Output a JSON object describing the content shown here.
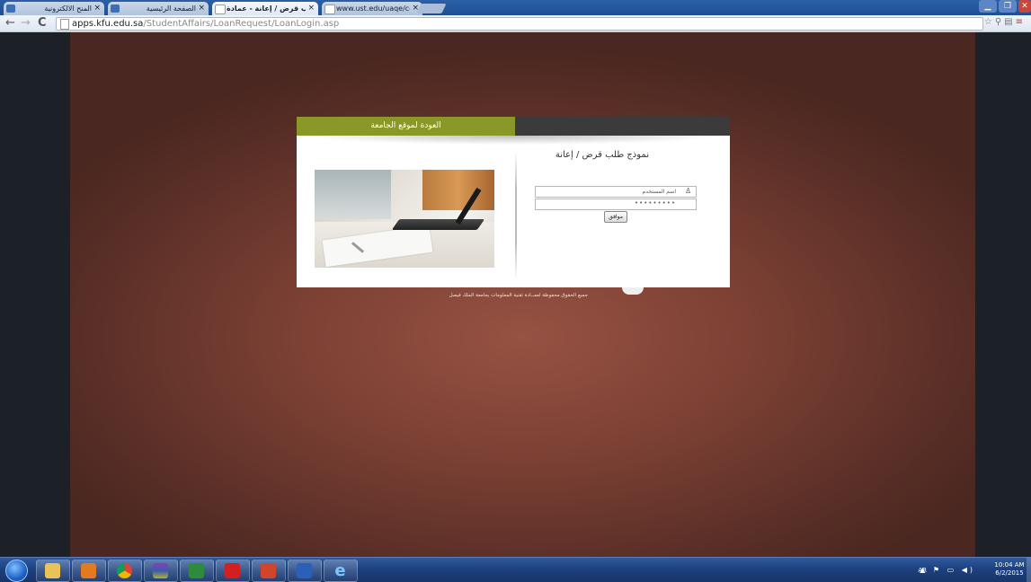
{
  "browser": {
    "tabs": [
      {
        "title": "المنح الالكترونية",
        "active": false
      },
      {
        "title": "الصفحة الرئيسية",
        "active": false
      },
      {
        "title": "نموذج طلب قرض / إعانة - عمادة",
        "active": true
      },
      {
        "title": "www.ust.edu/uaqe/cours",
        "active": false
      }
    ],
    "tab_close": "×",
    "url_host": "apps.kfu.edu.sa",
    "url_path": "/StudentAffairs/LoanRequest/LoanLogin.asp"
  },
  "page": {
    "back_link": "العودة لموقع الجامعة",
    "form_title": "نموذج طلب قرض / إعانة",
    "username_placeholder": "اسم المستخدم",
    "password_mask": "•••••••••",
    "submit_label": "موافق",
    "footer": "جميع الحقوق محفوظة لعمــادة تقنية المعلومات بجامعة الملك فيصل"
  },
  "taskbar": {
    "apps": [
      "internet-explorer-icon",
      "file-explorer-icon",
      "outlook-icon",
      "chrome-icon",
      "winrar-icon",
      "excel-icon",
      "acrobat-icon",
      "powerpoint-icon",
      "word-icon",
      "ie-icon"
    ],
    "language": "AR",
    "time": "10:04 AM",
    "date": "6/2/2015"
  },
  "colors": {
    "accent_green": "#8a9827",
    "header_dark": "#3b3b3b",
    "background_brown": "#7a3f33"
  }
}
